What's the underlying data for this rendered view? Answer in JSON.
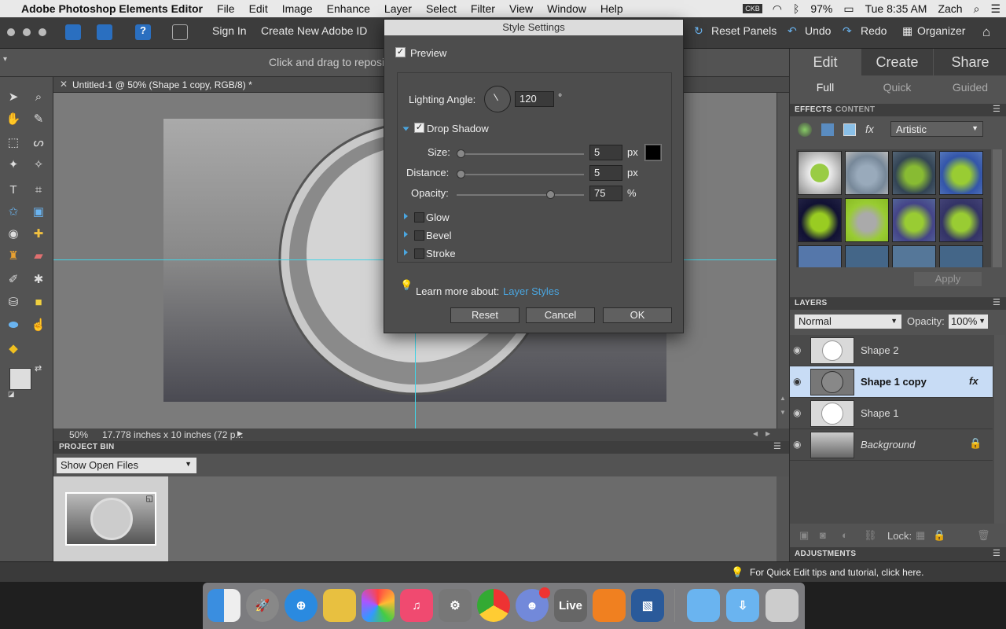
{
  "menubar": {
    "app_name": "Adobe Photoshop Elements Editor",
    "items": [
      "File",
      "Edit",
      "Image",
      "Enhance",
      "Layer",
      "Select",
      "Filter",
      "View",
      "Window",
      "Help"
    ],
    "battery": "97%",
    "clock": "Tue 8:35 AM",
    "user": "Zach"
  },
  "toolbar": {
    "sign_in": "Sign In",
    "create_id": "Create New Adobe ID",
    "reset_panels": "Reset Panels",
    "undo": "Undo",
    "redo": "Redo",
    "organizer": "Organizer"
  },
  "options_bar": {
    "hint": "Click and drag to reposit"
  },
  "document": {
    "tab_title": "Untitled-1 @ 50% (Shape 1 copy, RGB/8) *",
    "zoom": "50%",
    "doc_info": "17.778 inches x 10 inches (72 p..."
  },
  "project_bin": {
    "title": "PROJECT BIN",
    "filter": "Show Open Files"
  },
  "panel": {
    "tabs": [
      "Edit",
      "Create",
      "Share"
    ],
    "modes": [
      "Full",
      "Quick",
      "Guided"
    ],
    "effects_tab": "EFFECTS",
    "content_tab": "CONTENT",
    "effects_category": "Artistic",
    "apply": "Apply",
    "layers_title": "LAYERS",
    "blend_mode": "Normal",
    "opacity_label": "Opacity:",
    "opacity_value": "100%",
    "layers": [
      {
        "name": "Shape 2"
      },
      {
        "name": "Shape 1 copy",
        "fx": "fx"
      },
      {
        "name": "Shape 1"
      },
      {
        "name": "Background"
      }
    ],
    "lock_label": "Lock:",
    "adjustments_title": "ADJUSTMENTS"
  },
  "info_bar": {
    "tip": "For Quick Edit tips and tutorial, click here."
  },
  "dialog": {
    "title": "Style Settings",
    "preview_label": "Preview",
    "lighting_angle_label": "Lighting Angle:",
    "lighting_angle_value": "120",
    "degree_symbol": "°",
    "drop_shadow_label": "Drop Shadow",
    "size_label": "Size:",
    "size_value": "5",
    "size_unit": "px",
    "distance_label": "Distance:",
    "distance_value": "5",
    "distance_unit": "px",
    "opacity_label": "Opacity:",
    "opacity_value": "75",
    "opacity_unit": "%",
    "shadow_color": "#000000",
    "glow_label": "Glow",
    "bevel_label": "Bevel",
    "stroke_label": "Stroke",
    "learn_more": "Learn more about:",
    "learn_more_link": "Layer Styles",
    "reset": "Reset",
    "cancel": "Cancel",
    "ok": "OK"
  },
  "dock": {
    "live_label": "Live"
  },
  "colors": {
    "accent": "#4aa6e0",
    "selected_layer": "#c8dcf5",
    "guide": "#43d4e6"
  }
}
